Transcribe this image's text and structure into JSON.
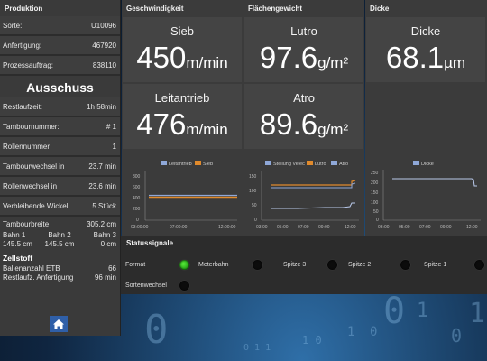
{
  "colors": {
    "led_on": "#2bbf1a",
    "led_off": "#0c0c0c",
    "home_button": "#2f5fa8",
    "series_blue": "#8fa8d8",
    "series_orange": "#e08a2c"
  },
  "production": {
    "header": "Produktion",
    "sorte": {
      "label": "Sorte:",
      "value": "U10096"
    },
    "anfertigung": {
      "label": "Anfertigung:",
      "value": "467920"
    },
    "prozessauftrag": {
      "label": "Prozessauftrag:",
      "value": "838110"
    },
    "ausschuss_title": "Ausschuss",
    "restlaufzeit": {
      "label": "Restlaufzeit:",
      "value": "1h 58min"
    },
    "tambournummer": {
      "label": "Tambournummer:",
      "value": "# 1"
    },
    "rollennummer": {
      "label": "Rollennummer",
      "value": "1"
    },
    "tambourwechsel": {
      "label": "Tambourwechsel in",
      "value": "23.7 min"
    },
    "rollenwechsel": {
      "label": "Rollenwechsel in",
      "value": "23.6 min"
    },
    "wickel": {
      "label": "Verbleibende Wickel:",
      "value": "5 Stück"
    },
    "tambourbreite": {
      "label": "Tambourbreite",
      "value": "305.2 cm"
    },
    "bahnen": [
      {
        "label": "Bahn 1",
        "value": "145.5 cm"
      },
      {
        "label": "Bahn 2",
        "value": "145.5 cm"
      },
      {
        "label": "Bahn 3",
        "value": "0 cm"
      }
    ],
    "zellstoff_title": "Zellstoff",
    "ballenanzahl": {
      "label": "Ballenanzahl ETB",
      "value": "66"
    },
    "restlaufz_anfertigung": {
      "label": "Restlaufz. Anfertigung",
      "value": "96 min"
    },
    "home_icon": "home-icon"
  },
  "geschwindigkeit": {
    "header": "Geschwindigkeit",
    "sieb": {
      "label": "Sieb",
      "value": "450",
      "unit": "m/min"
    },
    "leitantrieb": {
      "label": "Leitantrieb",
      "value": "476",
      "unit": "m/min"
    },
    "chart_data": {
      "type": "line",
      "series": [
        {
          "name": "Leitantrieb"
        },
        {
          "name": "Sieb"
        }
      ],
      "x_ticks": [
        "03:00:00",
        "07:00:00",
        "12:00:00"
      ],
      "y_ticks": [
        "800",
        "600",
        "400",
        "200",
        "0"
      ]
    }
  },
  "flaechengewicht": {
    "header": "Flächengewicht",
    "lutro": {
      "label": "Lutro",
      "value": "97.6",
      "unit": "g/m²"
    },
    "atro": {
      "label": "Atro",
      "value": "89.6",
      "unit": "g/m²"
    },
    "chart_data": {
      "type": "line",
      "series": [
        {
          "name": "Stellung Velec"
        },
        {
          "name": "Lutro"
        },
        {
          "name": "Atro"
        }
      ],
      "x_ticks": [
        "03:00",
        "05:00",
        "07:00",
        "09:00",
        "12:00"
      ],
      "y_ticks": [
        "150",
        "100",
        "50",
        "0"
      ]
    }
  },
  "dicke": {
    "header": "Dicke",
    "dicke": {
      "label": "Dicke",
      "value": "68.1",
      "unit": "µm"
    },
    "chart_data": {
      "type": "line",
      "series": [
        {
          "name": "Dicke"
        }
      ],
      "x_ticks": [
        "03:00",
        "05:00",
        "07:00",
        "09:00",
        "12:00"
      ],
      "y_ticks": [
        "250",
        "200",
        "150",
        "100",
        "50",
        "0"
      ]
    }
  },
  "statussignale": {
    "header": "Statussignale",
    "signals": [
      {
        "label": "Format",
        "active": true
      },
      {
        "label": "Meterbahn",
        "active": false
      },
      {
        "label": "Spitze 3",
        "active": false
      },
      {
        "label": "Spitze 2",
        "active": false
      },
      {
        "label": "Spitze 1",
        "active": false
      },
      {
        "label": "Sortenwechsel",
        "active": false
      }
    ]
  }
}
